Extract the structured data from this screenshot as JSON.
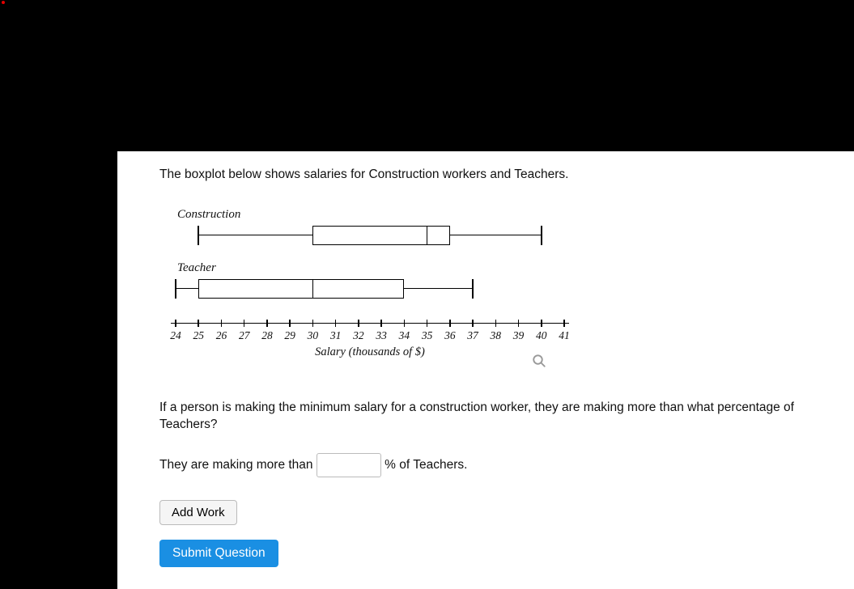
{
  "question": {
    "intro": "The boxplot below shows salaries for Construction workers and Teachers.",
    "prompt": "If a person is making the minimum salary for a construction worker, they are making more than what percentage of Teachers?",
    "answer_prefix": "They are making more than",
    "answer_suffix": "% of Teachers."
  },
  "buttons": {
    "add_work": "Add Work",
    "submit": "Submit Question"
  },
  "chart_data": {
    "type": "boxplot",
    "xlabel": "Salary (thousands of $)",
    "xlim": [
      24,
      41
    ],
    "ticks": [
      24,
      25,
      26,
      27,
      28,
      29,
      30,
      31,
      32,
      33,
      34,
      35,
      36,
      37,
      38,
      39,
      40,
      41
    ],
    "series": [
      {
        "name": "Construction",
        "min": 25,
        "q1": 30,
        "median": 35,
        "q3": 36,
        "max": 40
      },
      {
        "name": "Teacher",
        "min": 24,
        "q1": 25,
        "median": 30,
        "q3": 34,
        "max": 37
      }
    ]
  }
}
